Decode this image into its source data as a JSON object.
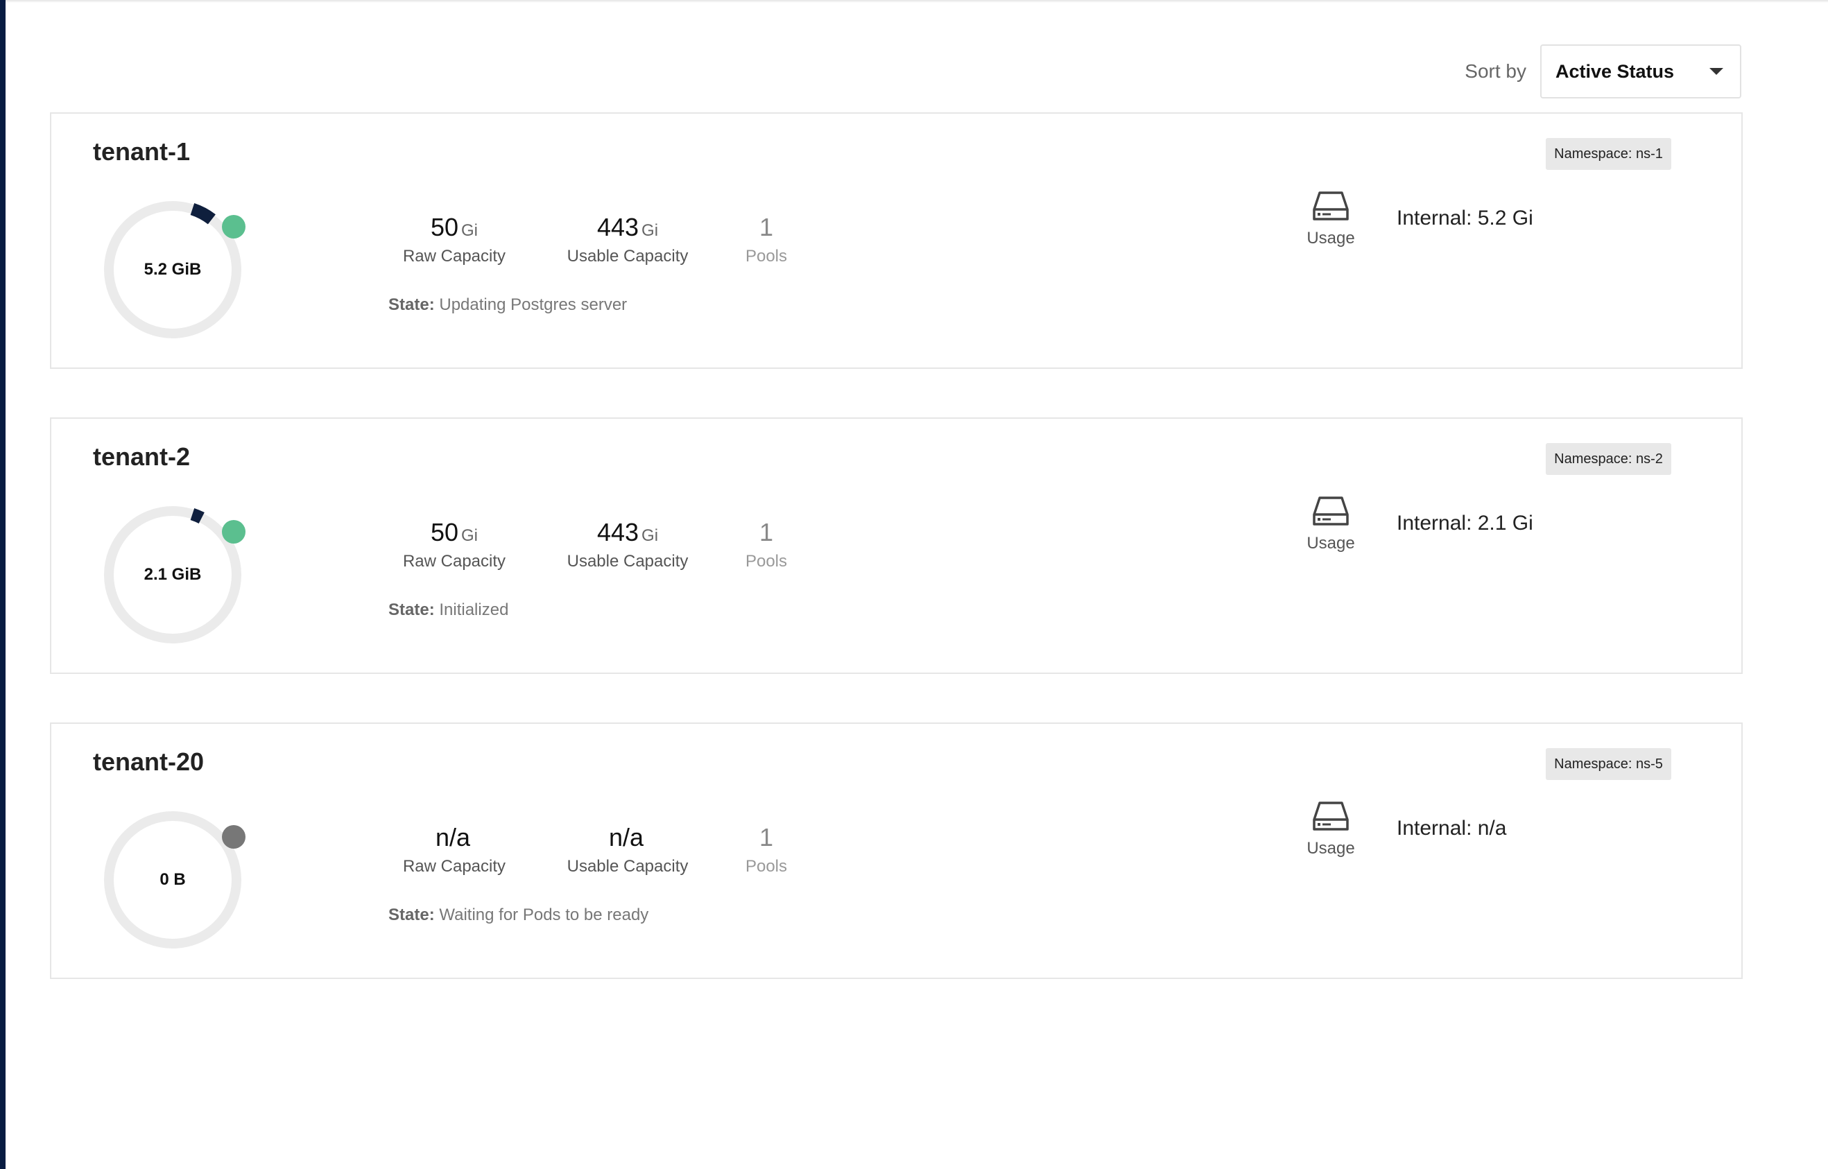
{
  "sort": {
    "label": "Sort by",
    "value": "Active Status"
  },
  "colors": {
    "accent_dark": "#0f1f3d",
    "track": "#ebebeb",
    "status_active": "#5bbf8f",
    "status_pending": "#777777"
  },
  "tenants": [
    {
      "name": "tenant-1",
      "namespace": "Namespace: ns-1",
      "usage_label": "5.2 GiB",
      "usage_fraction": 0.055,
      "status": "active",
      "raw_capacity": {
        "value": "50",
        "unit": "Gi",
        "label": "Raw Capacity"
      },
      "usable_capacity": {
        "value": "443",
        "unit": "Gi",
        "label": "Usable Capacity"
      },
      "pools": {
        "value": "1",
        "label": "Pools"
      },
      "state": {
        "key": "State:",
        "value": "Updating Postgres server"
      },
      "usage": {
        "icon": "hard-drive-icon",
        "label": "Usage"
      },
      "internal": "Internal: 5.2 Gi"
    },
    {
      "name": "tenant-2",
      "namespace": "Namespace: ns-2",
      "usage_label": "2.1 GiB",
      "usage_fraction": 0.025,
      "status": "active",
      "raw_capacity": {
        "value": "50",
        "unit": "Gi",
        "label": "Raw Capacity"
      },
      "usable_capacity": {
        "value": "443",
        "unit": "Gi",
        "label": "Usable Capacity"
      },
      "pools": {
        "value": "1",
        "label": "Pools"
      },
      "state": {
        "key": "State:",
        "value": "Initialized"
      },
      "usage": {
        "icon": "hard-drive-icon",
        "label": "Usage"
      },
      "internal": "Internal: 2.1 Gi"
    },
    {
      "name": "tenant-20",
      "namespace": "Namespace: ns-5",
      "usage_label": "0 B",
      "usage_fraction": 0,
      "status": "pending",
      "raw_capacity": {
        "value": "n/a",
        "unit": "",
        "label": "Raw Capacity"
      },
      "usable_capacity": {
        "value": "n/a",
        "unit": "",
        "label": "Usable Capacity"
      },
      "pools": {
        "value": "1",
        "label": "Pools"
      },
      "state": {
        "key": "State:",
        "value": "Waiting for Pods to be ready"
      },
      "usage": {
        "icon": "hard-drive-icon",
        "label": "Usage"
      },
      "internal": "Internal: n/a"
    }
  ]
}
